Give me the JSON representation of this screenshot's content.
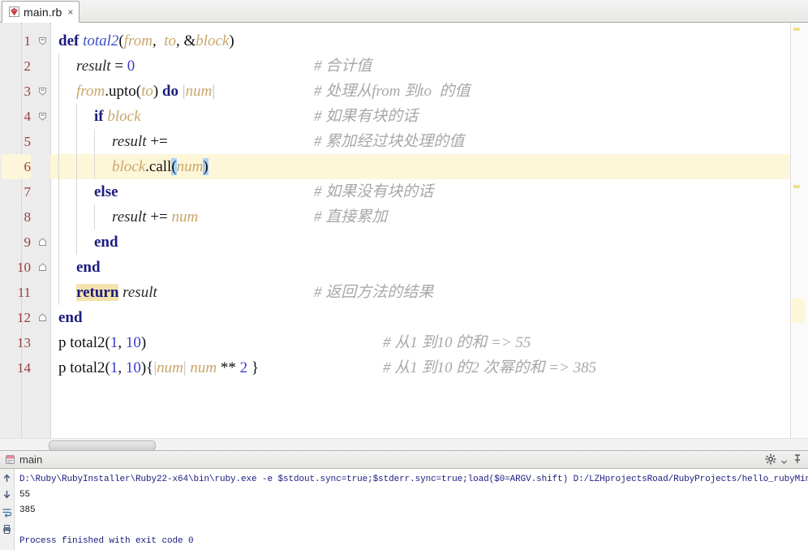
{
  "window": {
    "tab": {
      "label": "main.rb",
      "close_label": "×",
      "icon": "ruby-file-icon"
    }
  },
  "editor": {
    "line_numbers": [
      "1",
      "2",
      "3",
      "4",
      "5",
      "6",
      "7",
      "8",
      "9",
      "10",
      "11",
      "12",
      "13",
      "14"
    ],
    "current_line": 6,
    "lines": [
      {
        "n": 1,
        "indent": 0,
        "fold": "collapse",
        "segments": [
          {
            "t": "def",
            "c": "kw"
          },
          {
            "t": " ",
            "c": "plain"
          },
          {
            "t": "total2",
            "c": "meth"
          },
          {
            "t": "(",
            "c": "plain"
          },
          {
            "t": "from",
            "c": "param"
          },
          {
            "t": ",  ",
            "c": "plain"
          },
          {
            "t": "to",
            "c": "param"
          },
          {
            "t": ", &",
            "c": "plain"
          },
          {
            "t": "block",
            "c": "param"
          },
          {
            "t": ")",
            "c": "plain"
          }
        ],
        "comment": ""
      },
      {
        "n": 2,
        "indent": 1,
        "fold": "",
        "segments": [
          {
            "t": "result",
            "c": "ident"
          },
          {
            "t": " = ",
            "c": "plain"
          },
          {
            "t": "0",
            "c": "num"
          }
        ],
        "comment": "# 合计值"
      },
      {
        "n": 3,
        "indent": 1,
        "fold": "collapse",
        "segments": [
          {
            "t": "from",
            "c": "param"
          },
          {
            "t": ".",
            "c": "plain"
          },
          {
            "t": "upto",
            "c": "plain"
          },
          {
            "t": "(",
            "c": "plain"
          },
          {
            "t": "to",
            "c": "param"
          },
          {
            "t": ") ",
            "c": "plain"
          },
          {
            "t": "do",
            "c": "kw"
          },
          {
            "t": " ",
            "c": "plain"
          },
          {
            "t": "|",
            "c": "pipe"
          },
          {
            "t": "num",
            "c": "param"
          },
          {
            "t": "|",
            "c": "pipe"
          }
        ],
        "comment": "# 处理从from 到to  的值"
      },
      {
        "n": 4,
        "indent": 2,
        "fold": "collapse",
        "segments": [
          {
            "t": "if",
            "c": "kw"
          },
          {
            "t": " ",
            "c": "plain"
          },
          {
            "t": "block",
            "c": "param"
          }
        ],
        "comment": "# 如果有块的话"
      },
      {
        "n": 5,
        "indent": 3,
        "fold": "",
        "segments": [
          {
            "t": "result",
            "c": "ident"
          },
          {
            "t": " += ",
            "c": "plain"
          }
        ],
        "comment": "# 累加经过块处理的值"
      },
      {
        "n": 6,
        "indent": 3,
        "fold": "",
        "bulb": true,
        "segments": [
          {
            "t": "block",
            "c": "param"
          },
          {
            "t": ".",
            "c": "plain"
          },
          {
            "t": "call",
            "c": "plain"
          },
          {
            "t": "(",
            "c": "plain sel"
          },
          {
            "t": "num",
            "c": "param"
          },
          {
            "t": ")",
            "c": "plain sel"
          }
        ],
        "comment": ""
      },
      {
        "n": 7,
        "indent": 2,
        "fold": "",
        "segments": [
          {
            "t": "else",
            "c": "kw"
          }
        ],
        "comment": "# 如果没有块的话"
      },
      {
        "n": 8,
        "indent": 3,
        "fold": "",
        "segments": [
          {
            "t": "result",
            "c": "ident"
          },
          {
            "t": " += ",
            "c": "plain"
          },
          {
            "t": "num",
            "c": "param"
          }
        ],
        "comment": "# 直接累加"
      },
      {
        "n": 9,
        "indent": 2,
        "fold": "end",
        "segments": [
          {
            "t": "end",
            "c": "kw"
          }
        ],
        "comment": ""
      },
      {
        "n": 10,
        "indent": 1,
        "fold": "end",
        "segments": [
          {
            "t": "end",
            "c": "kw"
          }
        ],
        "comment": ""
      },
      {
        "n": 11,
        "indent": 1,
        "fold": "",
        "segments": [
          {
            "t": "return",
            "c": "kw retbox"
          },
          {
            "t": " ",
            "c": "plain"
          },
          {
            "t": "result",
            "c": "ident"
          }
        ],
        "comment": "# 返回方法的结果"
      },
      {
        "n": 12,
        "indent": 0,
        "fold": "end",
        "segments": [
          {
            "t": "end",
            "c": "kw"
          }
        ],
        "comment": ""
      },
      {
        "n": 13,
        "indent": 0,
        "fold": "",
        "segments": [
          {
            "t": "p",
            "c": "plain"
          },
          {
            "t": " ",
            "c": "plain"
          },
          {
            "t": "total2",
            "c": "plain"
          },
          {
            "t": "(",
            "c": "plain"
          },
          {
            "t": "1",
            "c": "num"
          },
          {
            "t": ", ",
            "c": "plain"
          },
          {
            "t": "10",
            "c": "num"
          },
          {
            "t": ")",
            "c": "plain"
          }
        ],
        "comment": "# 从1 到10 的和 => 55"
      },
      {
        "n": 14,
        "indent": 0,
        "fold": "",
        "segments": [
          {
            "t": "p",
            "c": "plain"
          },
          {
            "t": " ",
            "c": "plain"
          },
          {
            "t": "total2",
            "c": "plain"
          },
          {
            "t": "(",
            "c": "plain"
          },
          {
            "t": "1",
            "c": "num"
          },
          {
            "t": ", ",
            "c": "plain"
          },
          {
            "t": "10",
            "c": "num"
          },
          {
            "t": "){",
            "c": "plain"
          },
          {
            "t": "|",
            "c": "pipe"
          },
          {
            "t": "num",
            "c": "param"
          },
          {
            "t": "|",
            "c": "pipe"
          },
          {
            "t": " ",
            "c": "plain"
          },
          {
            "t": "num",
            "c": "param"
          },
          {
            "t": " ** ",
            "c": "plain"
          },
          {
            "t": "2",
            "c": "num"
          },
          {
            "t": " }",
            "c": "plain"
          }
        ],
        "comment": "# 从1 到10 的2 次幂的和 => 385"
      }
    ]
  },
  "console": {
    "title": "main",
    "title_icon": "run-config-icon",
    "settings_icon": "gear-icon",
    "settings_dropdown_icon": "chevron-down-icon",
    "pin_icon": "pin-icon",
    "toolbar_icons": [
      "arrow-up-icon",
      "arrow-down-icon",
      "soft-wrap-icon",
      "print-icon"
    ],
    "output": [
      {
        "text": "D:\\Ruby\\RubyInstaller\\Ruby22-x64\\bin\\ruby.exe -e $stdout.sync=true;$stderr.sync=true;load($0=ARGV.shift) D:/LZHprojectsRoad/RubyProjects/hello_rubyMine/main.rb",
        "kind": "sys"
      },
      {
        "text": "55",
        "kind": "out"
      },
      {
        "text": "385",
        "kind": "out"
      },
      {
        "text": "",
        "kind": "out"
      },
      {
        "text": "Process finished with exit code 0",
        "kind": "sys"
      }
    ]
  },
  "colors": {
    "current_line_bg": "#fdf6d8",
    "selection_bg": "#a6d2ff",
    "return_highlight_bg": "#f3e2ae",
    "keyword": "#1b1b7e",
    "method": "#3b52c4",
    "param": "#c9a66b",
    "number": "#3b3bcd",
    "comment": "#a8a8a8",
    "line_number": "#97413b"
  }
}
